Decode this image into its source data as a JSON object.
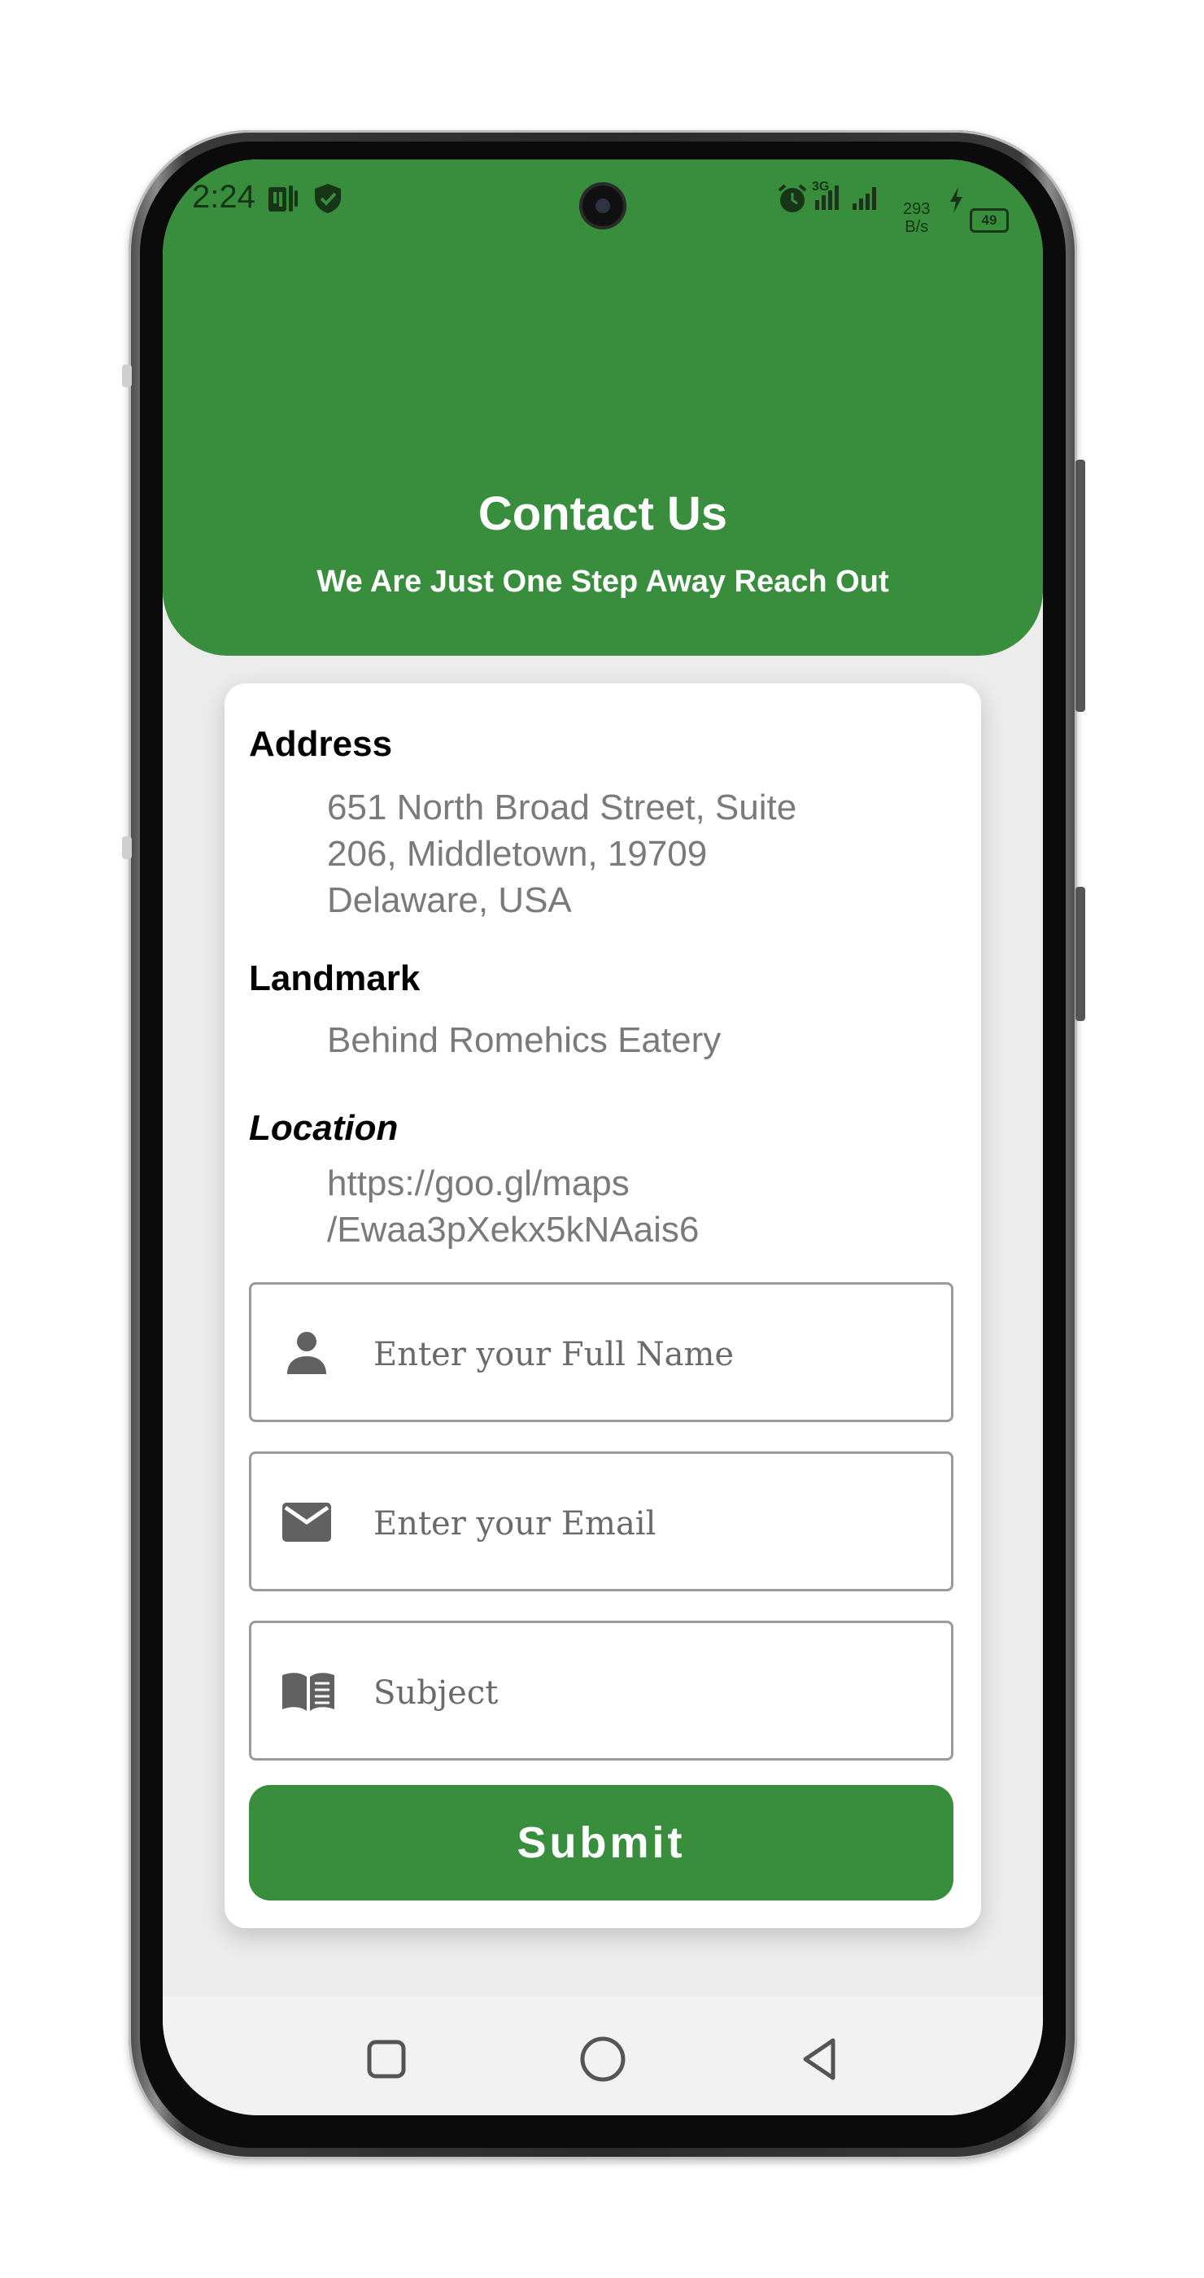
{
  "status_bar": {
    "time": "2:24",
    "net_speed_value": "293",
    "net_speed_unit": "B/s",
    "signal_label": "3G",
    "battery": "49"
  },
  "header": {
    "title": "Contact Us",
    "subtitle": "We Are Just One Step Away Reach Out",
    "color": "#388e3c"
  },
  "info": {
    "address_label": "Address",
    "address_line1": "651 North Broad Street, Suite",
    "address_line2": "206, Middletown, 19709",
    "address_line3": "Delaware, USA",
    "landmark_label": "Landmark",
    "landmark_value": "Behind Romehics Eatery",
    "location_label": "Location",
    "location_line1": "https://goo.gl/maps",
    "location_line2": "/Ewaa3pXekx5kNAais6"
  },
  "form": {
    "name_placeholder": "Enter your Full Name",
    "name_icon": "person-icon",
    "email_placeholder": "Enter your Email",
    "email_icon": "envelope-icon",
    "subject_placeholder": "Subject",
    "subject_icon": "book-icon",
    "submit_label": "Submit"
  },
  "nav": {
    "recents_icon": "square-icon",
    "home_icon": "circle-icon",
    "back_icon": "triangle-back-icon"
  }
}
